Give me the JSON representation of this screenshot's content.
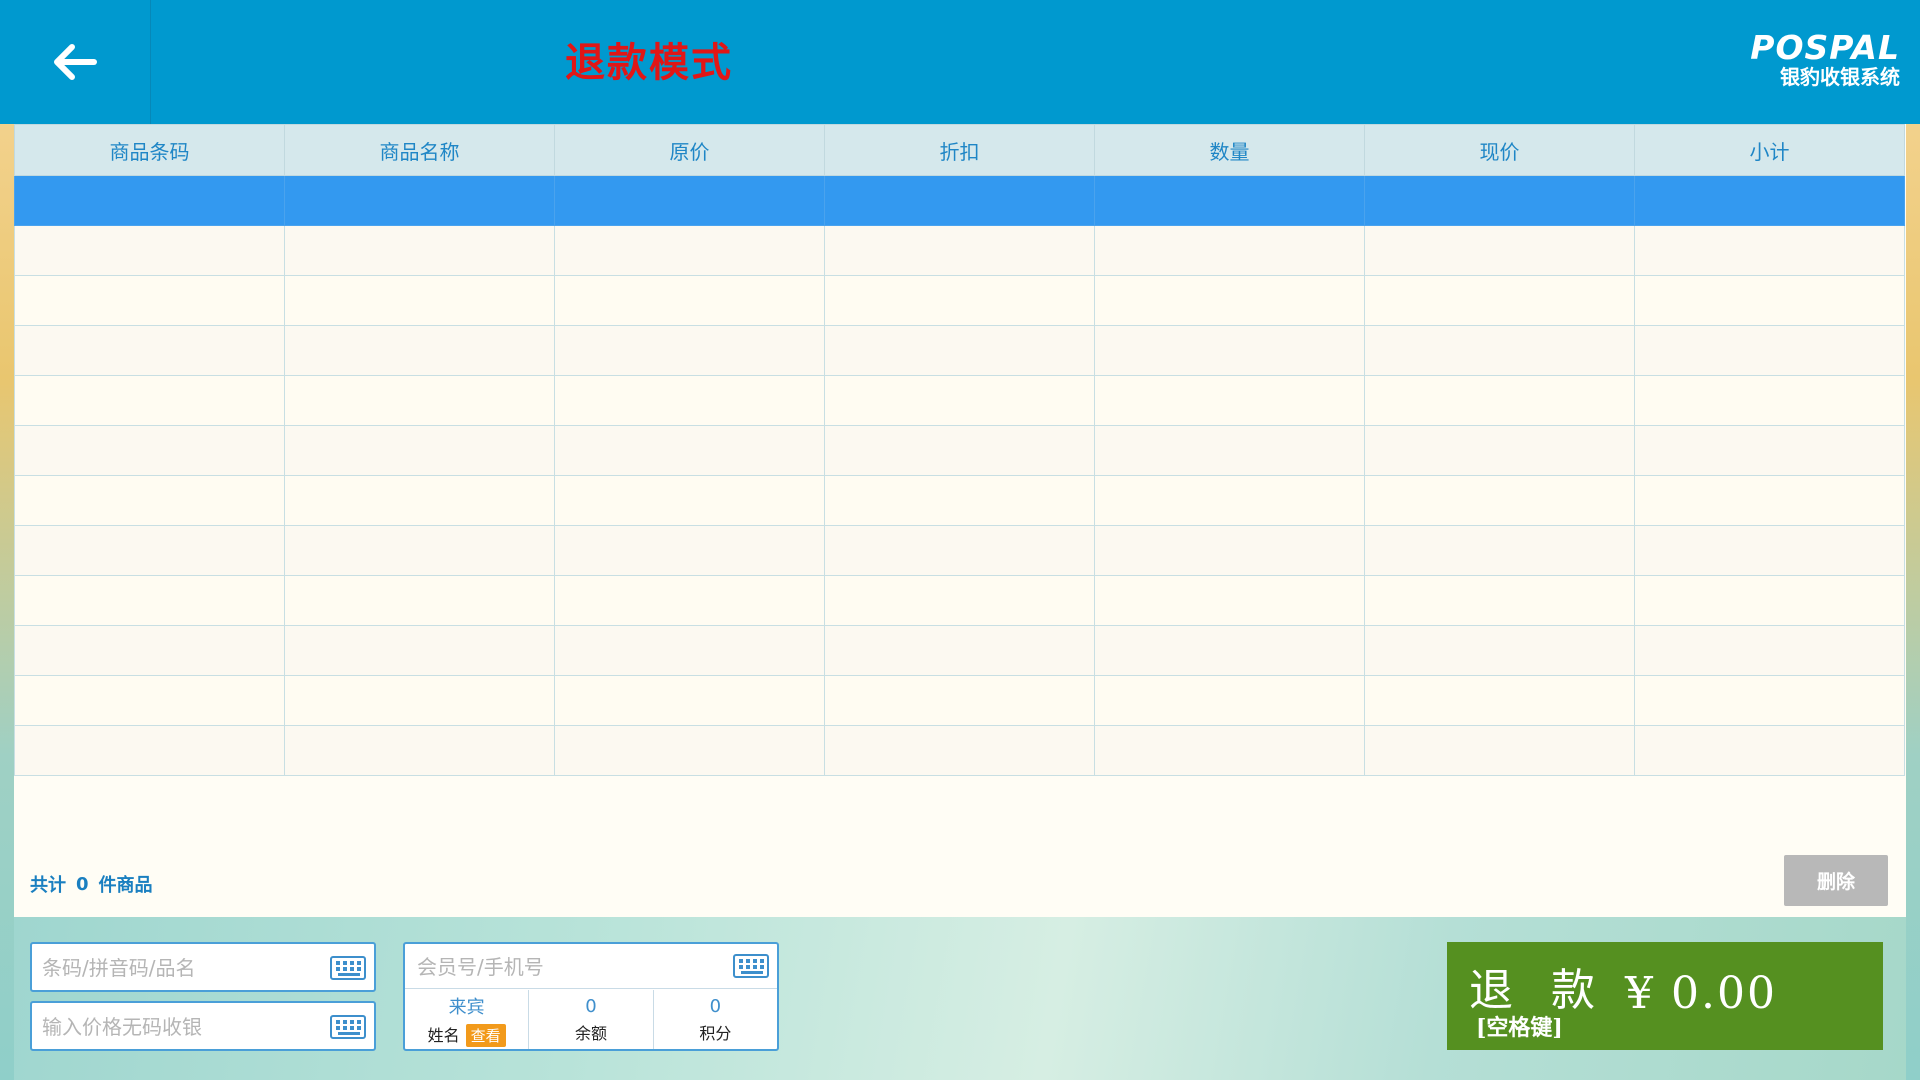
{
  "header": {
    "title": "退款模式",
    "logo_mark": "POSPAL",
    "logo_sub": "银豹收银系统"
  },
  "table": {
    "columns": [
      "商品条码",
      "商品名称",
      "原价",
      "折扣",
      "数量",
      "现价",
      "小计"
    ],
    "row_count": 12,
    "selected_row": 0
  },
  "summary": {
    "prefix": "共计",
    "count": "0",
    "suffix": "件商品"
  },
  "delete_label": "删除",
  "inputs": {
    "barcode_placeholder": "条码/拼音码/品名",
    "price_placeholder": "输入价格无码收银",
    "member_placeholder": "会员号/手机号"
  },
  "member": {
    "name_value": "来宾",
    "name_label": "姓名",
    "view_label": "查看",
    "balance_value": "0",
    "balance_label": "余额",
    "points_value": "0",
    "points_label": "积分"
  },
  "refund": {
    "label": "退 款",
    "shortcut": "[空格键]",
    "amount": "¥ 0.00"
  },
  "colors": {
    "header_bg": "#0099cf",
    "title": "#e11616",
    "selected_row": "#3399f0",
    "refund_button": "#559020",
    "view_badge": "#f29a1b"
  },
  "icons": {
    "back": "back-arrow-icon",
    "keyboard": "keyboard-icon"
  }
}
